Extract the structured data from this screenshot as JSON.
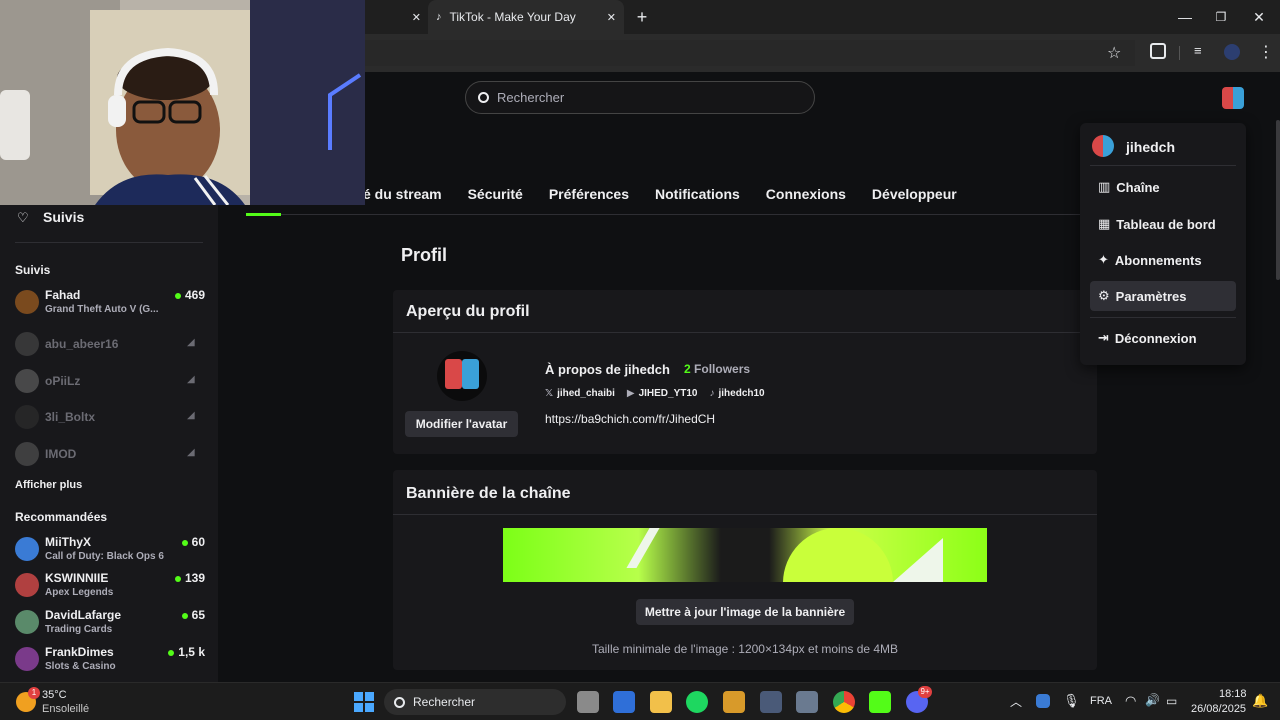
{
  "browser": {
    "tab_title": "TikTok - Make Your Day",
    "tab_close": "✕",
    "new_tab": "+",
    "win_min": "—",
    "win_max": "❐",
    "win_close": "✕"
  },
  "search": {
    "placeholder": "Rechercher"
  },
  "settings_tabs": [
    "é du stream",
    "Sécurité",
    "Préférences",
    "Notifications",
    "Connexions",
    "Développeur"
  ],
  "sidebar": {
    "top_label": "Suivis",
    "followed_header": "Suivis",
    "followed": [
      {
        "name": "Fahad",
        "game": "Grand Theft Auto V (G...",
        "viewers": "469",
        "color": "#7a4a1e"
      },
      {
        "name": "abu_abeer16",
        "offline": true
      },
      {
        "name": "oPiiLz",
        "offline": true
      },
      {
        "name": "3li_Boltx",
        "offline": true
      },
      {
        "name": "IMOD",
        "offline": true
      }
    ],
    "show_more": "Afficher plus",
    "recommended_header": "Recommandées",
    "recommended": [
      {
        "name": "MiiThyX",
        "game": "Call of Duty: Black Ops 6",
        "viewers": "60",
        "color": "#3a7bd5"
      },
      {
        "name": "KSWINNIIE",
        "game": "Apex Legends",
        "viewers": "139",
        "color": "#b04040"
      },
      {
        "name": "DavidLafarge",
        "game": "Trading Cards",
        "viewers": "65",
        "color": "#5a8a6a"
      },
      {
        "name": "FrankDimes",
        "game": "Slots & Casino",
        "viewers": "1,5 k",
        "color": "#7a3a8a"
      }
    ]
  },
  "profile": {
    "heading": "Profil",
    "preview_title": "Aperçu du profil",
    "edit_avatar": "Modifier l'avatar",
    "about": "À propos de jihedch",
    "followers_count": "2",
    "followers_label": "Followers",
    "socials": [
      {
        "icon": "x-icon",
        "glyph": "𝕏",
        "label": "jihed_chaibi"
      },
      {
        "icon": "youtube-icon",
        "glyph": "▶",
        "label": "JIHED_YT10"
      },
      {
        "icon": "tiktok-icon",
        "glyph": "♪",
        "label": "jihedch10"
      }
    ],
    "link": "https://ba9chich.com/fr/JihedCH"
  },
  "banner": {
    "title": "Bannière de la chaîne",
    "update_button": "Mettre à jour l'image de la bannière",
    "hint": "Taille minimale de l'image : 1200×134px et moins de 4MB"
  },
  "menu": {
    "username": "jihedch",
    "items": [
      {
        "label": "Chaîne",
        "icon": "channel-icon",
        "glyph": "▥"
      },
      {
        "label": "Tableau de bord",
        "icon": "dashboard-icon",
        "glyph": "▦"
      },
      {
        "label": "Abonnements",
        "icon": "sparkle-icon",
        "glyph": "✦"
      },
      {
        "label": "Paramètres",
        "icon": "gear-icon",
        "glyph": "⚙"
      },
      {
        "label": "Déconnexion",
        "icon": "logout-icon",
        "glyph": "⇥"
      }
    ]
  },
  "taskbar": {
    "weather_temp": "35°C",
    "weather_desc": "Ensoleillé",
    "search": "Rechercher",
    "lang": "FRA",
    "time": "18:18",
    "date": "26/08/2025",
    "weather_badge": "1",
    "discord_badge": "9+"
  },
  "colors": {
    "accent": "#53fc18",
    "bg": "#0f1012",
    "card": "#18181b"
  }
}
